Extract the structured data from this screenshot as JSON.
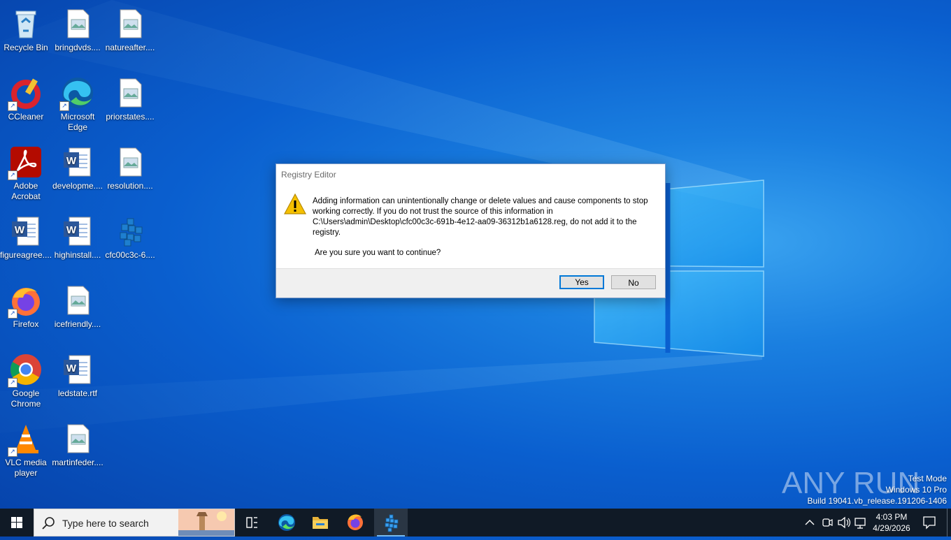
{
  "desktop": {
    "icons": [
      {
        "label": "Recycle Bin",
        "icon": "recycle-bin-icon"
      },
      {
        "label": "bringdvds....",
        "icon": "image-file-icon"
      },
      {
        "label": "natureafter....",
        "icon": "image-file-icon"
      },
      {
        "label": "CCleaner",
        "icon": "ccleaner-icon"
      },
      {
        "label": "Microsoft Edge",
        "icon": "edge-icon"
      },
      {
        "label": "priorstates....",
        "icon": "image-file-icon"
      },
      {
        "label": "Adobe Acrobat",
        "icon": "acrobat-icon"
      },
      {
        "label": "developme....",
        "icon": "word-doc-icon"
      },
      {
        "label": "resolution....",
        "icon": "image-file-icon"
      },
      {
        "label": "figureagree....",
        "icon": "word-doc-icon"
      },
      {
        "label": "highinstall....",
        "icon": "word-doc-icon"
      },
      {
        "label": "cfc00c3c-6....",
        "icon": "registry-file-icon"
      },
      {
        "label": "Firefox",
        "icon": "firefox-icon"
      },
      {
        "label": "icefriendly....",
        "icon": "image-file-icon"
      },
      {
        "label": "Google Chrome",
        "icon": "chrome-icon"
      },
      {
        "label": "ledstate.rtf",
        "icon": "word-doc-icon"
      },
      {
        "label": "VLC media player",
        "icon": "vlc-icon"
      },
      {
        "label": "martinfeder....",
        "icon": "image-file-icon"
      }
    ]
  },
  "dialog": {
    "title": "Registry Editor",
    "message": "Adding information can unintentionally change or delete values and cause components to stop working correctly. If you do not trust the source of this information in C:\\Users\\admin\\Desktop\\cfc00c3c-691b-4e12-aa09-36312b1a6128.reg, do not add it to the registry.",
    "question": "Are you sure you want to continue?",
    "yes_label": "Yes",
    "no_label": "No"
  },
  "watermark": {
    "line1": "Test Mode",
    "line2": "Windows 10 Pro",
    "line3": "Build 19041.vb_release.191206-1406",
    "brand": "ANY RUN"
  },
  "taskbar": {
    "search_placeholder": "Type here to search",
    "pinned": [
      "task-view-icon",
      "edge-icon",
      "file-explorer-icon",
      "firefox-icon",
      "registry-editor-icon"
    ],
    "clock_time": "4:03 PM",
    "clock_date": "4/29/2026"
  },
  "colors": {
    "accent": "#0078d7",
    "taskbar": "#101a26",
    "warning": "#f5c000"
  }
}
